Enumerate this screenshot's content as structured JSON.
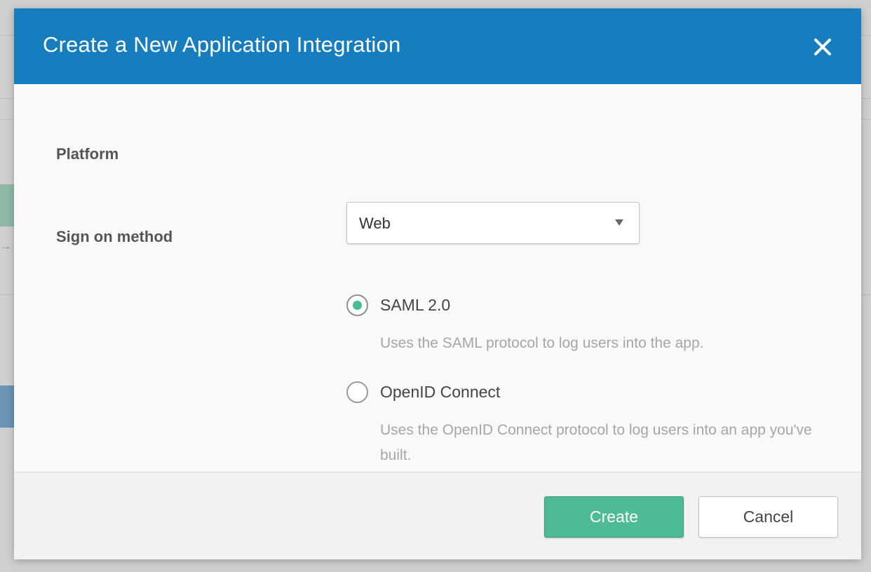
{
  "modal": {
    "title": "Create a New Application Integration",
    "close_icon": "close-icon"
  },
  "form": {
    "platform": {
      "label": "Platform",
      "selected": "Web"
    },
    "sign_on_method": {
      "label": "Sign on method",
      "options": [
        {
          "label": "SAML 2.0",
          "description": "Uses the SAML protocol to log users into the app.",
          "checked": true
        },
        {
          "label": "OpenID Connect",
          "description": "Uses the OpenID Connect protocol to log users into an app you've built.",
          "checked": false
        }
      ]
    }
  },
  "footer": {
    "create_label": "Create",
    "cancel_label": "Cancel"
  },
  "colors": {
    "header": "#167ebf",
    "accent": "#4dbb95",
    "radio_dot": "#47bb94"
  }
}
